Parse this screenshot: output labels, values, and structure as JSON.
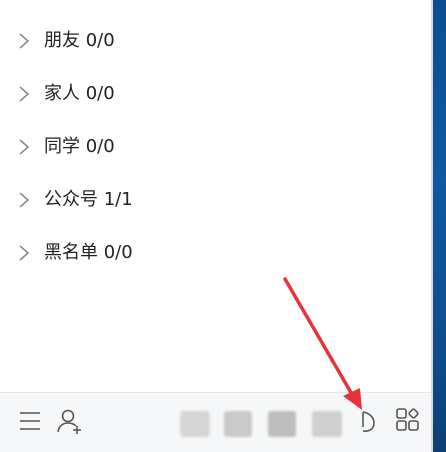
{
  "groups": [
    {
      "name": "朋友",
      "count": "0/0"
    },
    {
      "name": "家人",
      "count": "0/0"
    },
    {
      "name": "同学",
      "count": "0/0"
    },
    {
      "name": "公众号",
      "count": "1/1"
    },
    {
      "name": "黑名单",
      "count": "0/0"
    }
  ],
  "labels": {
    "g0": "朋友 0/0",
    "g1": "家人 0/0",
    "g2": "同学 0/0",
    "g3": "公众号 1/1",
    "g4": "黑名单 0/0"
  },
  "toolbar": {
    "icons": [
      "menu-icon",
      "add-contact-icon",
      "app-icon-1",
      "app-icon-2",
      "app-icon-3",
      "app-icon-4",
      "music-icon",
      "app-manager-icon"
    ]
  },
  "colors": {
    "annotation_arrow": "#e8323a",
    "text": "#222222",
    "icon": "#555555",
    "toolbar_bg": "#f6f7f8"
  }
}
